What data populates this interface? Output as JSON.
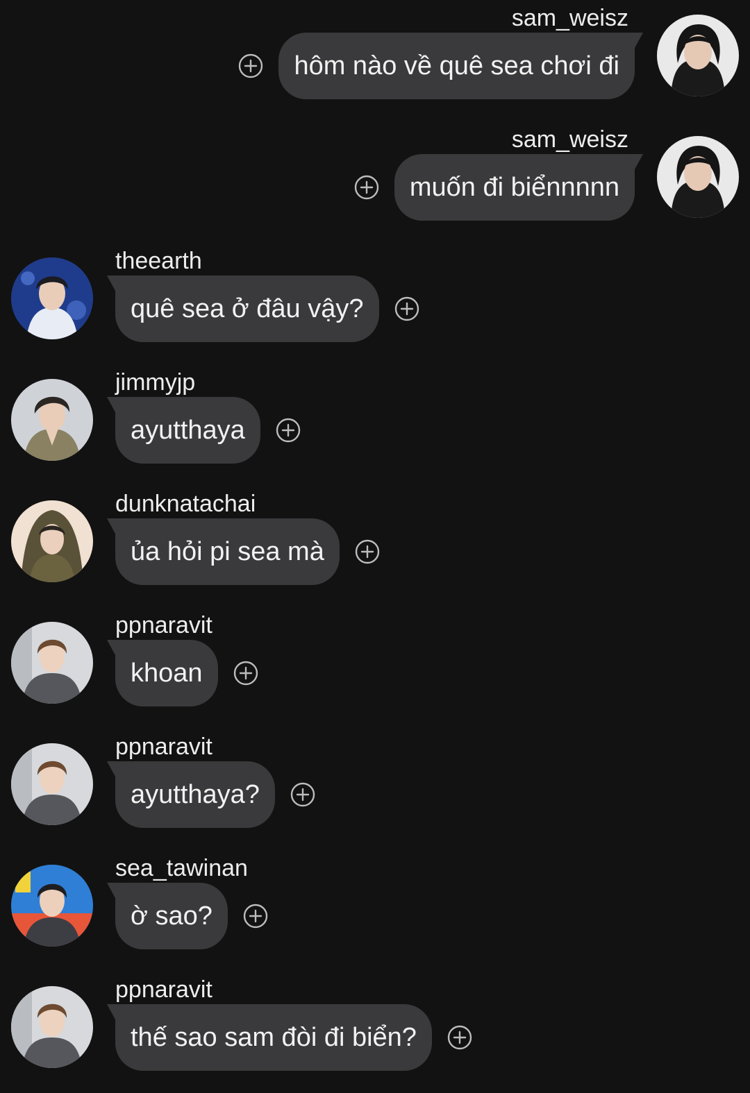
{
  "colors": {
    "background": "#121212",
    "bubble": "#3a3a3c",
    "text": "#f2f2f2",
    "icon": "#bdbdbd"
  },
  "messages": [
    {
      "side": "right",
      "username": "sam_weisz",
      "text": "hôm nào về quê sea chơi đi",
      "avatar": "avatar-sam",
      "action_icon": "add-reaction-icon"
    },
    {
      "side": "right",
      "username": "sam_weisz",
      "text": "muốn đi biểnnnnn",
      "avatar": "avatar-sam",
      "action_icon": "add-reaction-icon"
    },
    {
      "side": "left",
      "username": "theearth",
      "text": "quê sea ở đâu vậy?",
      "avatar": "avatar-theearth",
      "action_icon": "add-reaction-icon"
    },
    {
      "side": "left",
      "username": "jimmyjp",
      "text": "ayutthaya",
      "avatar": "avatar-jimmyjp",
      "action_icon": "add-reaction-icon"
    },
    {
      "side": "left",
      "username": "dunknatachai",
      "text": "ủa hỏi pi sea mà",
      "avatar": "avatar-dunknatachai",
      "action_icon": "add-reaction-icon"
    },
    {
      "side": "left",
      "username": "ppnaravit",
      "text": "khoan",
      "avatar": "avatar-ppnaravit",
      "action_icon": "add-reaction-icon"
    },
    {
      "side": "left",
      "username": "ppnaravit",
      "text": "ayutthaya?",
      "avatar": "avatar-ppnaravit",
      "action_icon": "add-reaction-icon"
    },
    {
      "side": "left",
      "username": "sea_tawinan",
      "text": "ờ sao?",
      "avatar": "avatar-sea-tawinan",
      "action_icon": "add-reaction-icon"
    },
    {
      "side": "left",
      "username": "ppnaravit",
      "text": "thế sao sam đòi đi biển?",
      "avatar": "avatar-ppnaravit",
      "action_icon": "add-reaction-icon"
    }
  ]
}
